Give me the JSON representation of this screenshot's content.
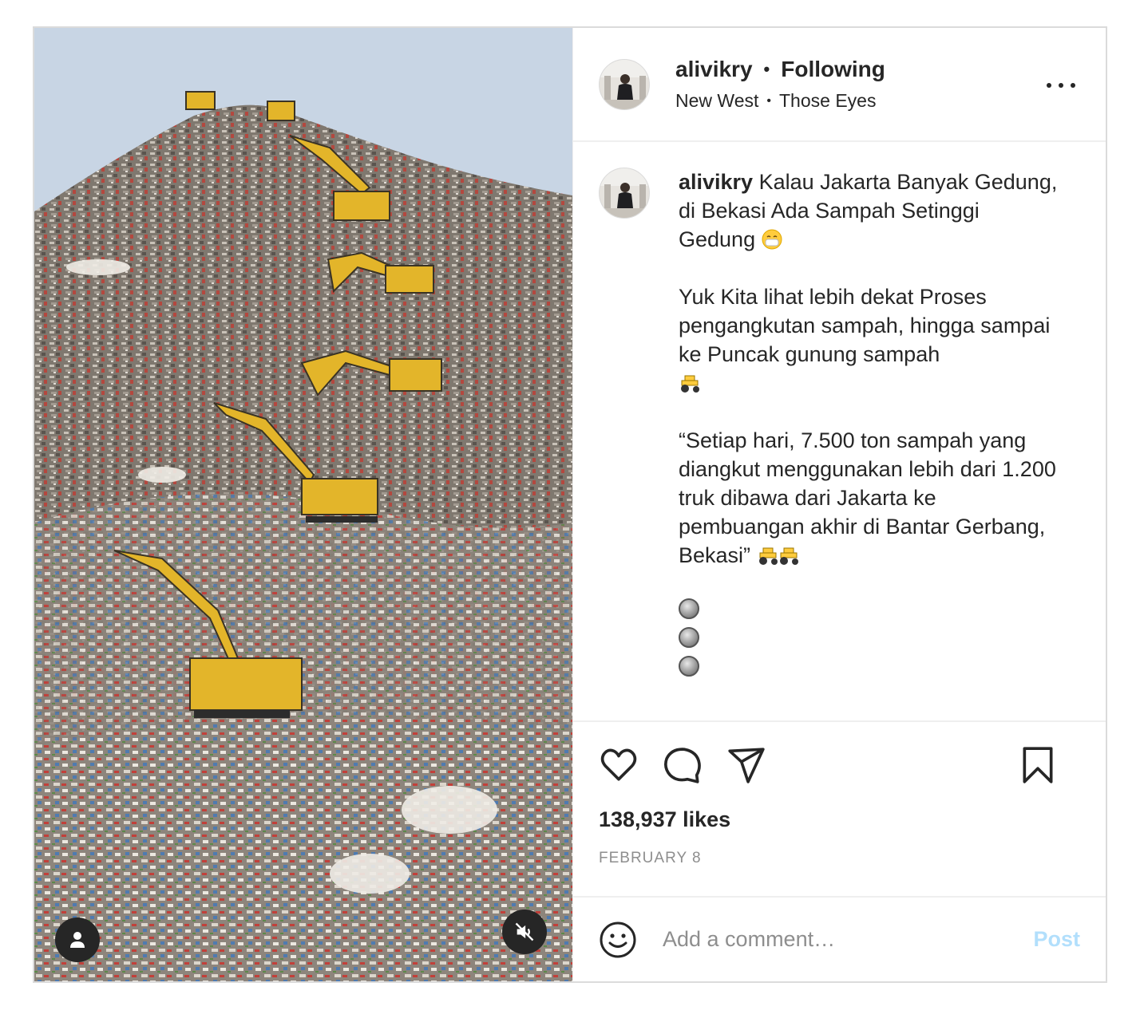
{
  "colors": {
    "text": "#262626",
    "secondary": "#8e8e8e",
    "border": "#dbdbdb",
    "post_disabled": "#b2dffc"
  },
  "media": {
    "user_icon": "user-icon",
    "mute_icon": "volume-muted-icon"
  },
  "header": {
    "username": "alivikry",
    "separator": "•",
    "follow_status": "Following",
    "location": "New West",
    "location_separator": "•",
    "audio": "Those Eyes",
    "more_icon": "more-horizontal-icon"
  },
  "caption": {
    "username": "alivikry",
    "line1": "Kalau Jakarta Banyak Gedung, di Bekasi Ada Sampah Setinggi Gedung",
    "para2": "Yuk Kita lihat lebih dekat Proses pengangkutan sampah, hingga sampai ke Puncak gunung sampah",
    "para3": "“Setiap hari, 7.500 ton sampah yang diangkut menggunakan lebih dari 1.200 truk dibawa dari Jakarta ke pembuangan akhir di Bantar Gerbang, Bekasi”",
    "emojis": [
      "face-with-mask-emoji",
      "tractor-emoji",
      "tractor-emoji",
      "tractor-emoji"
    ],
    "bullet_count": 3
  },
  "actions": {
    "like_icon": "heart-icon",
    "comment_icon": "comment-icon",
    "share_icon": "send-icon",
    "save_icon": "bookmark-icon"
  },
  "likes": "138,937 likes",
  "date": "FEBRUARY 8",
  "comment": {
    "emoji_icon": "smiley-icon",
    "placeholder": "Add a comment…",
    "post_label": "Post"
  }
}
